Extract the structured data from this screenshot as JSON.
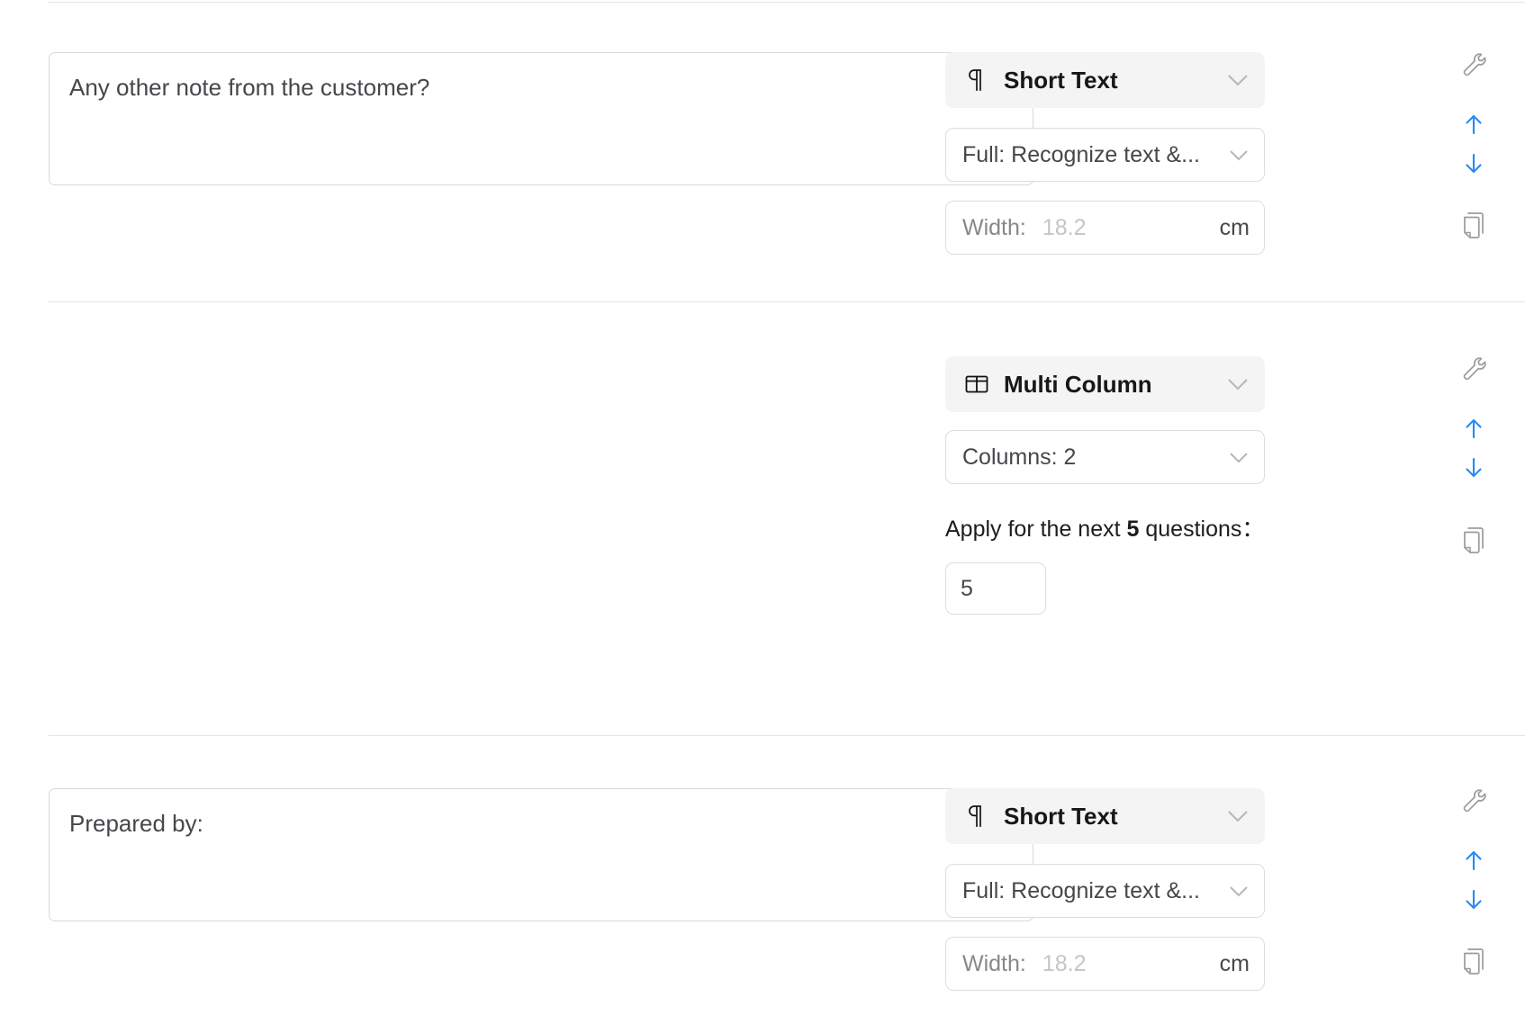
{
  "app": {
    "context": "form-question-editor",
    "accent_color": "#2689f5",
    "icon_grey": "#9a9c9f",
    "panel_bg": "#f4f4f5",
    "border_color": "#dcdddf"
  },
  "questions": [
    {
      "id": "q-any-other-note",
      "text": "Any other note from the customer?",
      "placeholder": "",
      "type": {
        "label": "Short Text",
        "icon": "pilcrow-icon"
      },
      "recognition": {
        "label": "Full: Recognize text &...",
        "icon": "chevron-down-icon"
      },
      "width": {
        "label": "Width:",
        "value": "18.2",
        "unit": "cm"
      },
      "tools": [
        {
          "name": "wrench-icon",
          "color": "#9a9c9f"
        },
        {
          "name": "arrow-up-icon",
          "color": "#2689f5"
        },
        {
          "name": "arrow-down-icon",
          "color": "#2689f5"
        },
        {
          "name": "duplicate-icon",
          "color": "#9a9c9f"
        }
      ]
    },
    {
      "id": "q-multi-column",
      "text": "",
      "placeholder": "",
      "type": {
        "label": "Multi Column",
        "icon": "multi-column-icon"
      },
      "columns": {
        "label": "Columns: 2",
        "icon": "chevron-down-icon"
      },
      "apply": {
        "prefix": "Apply for the next ",
        "count": "5",
        "suffix": " questions：",
        "input_value": "5"
      },
      "tools": [
        {
          "name": "wrench-icon",
          "color": "#9a9c9f"
        },
        {
          "name": "arrow-up-icon",
          "color": "#2689f5"
        },
        {
          "name": "arrow-down-icon",
          "color": "#2689f5"
        },
        {
          "name": "duplicate-icon",
          "color": "#9a9c9f"
        }
      ]
    },
    {
      "id": "q-prepared-by",
      "text": "Prepared by:",
      "placeholder": "",
      "type": {
        "label": "Short Text",
        "icon": "pilcrow-icon"
      },
      "recognition": {
        "label": "Full: Recognize text &...",
        "icon": "chevron-down-icon"
      },
      "width": {
        "label": "Width:",
        "value": "18.2",
        "unit": "cm"
      },
      "tools": [
        {
          "name": "wrench-icon",
          "color": "#9a9c9f"
        },
        {
          "name": "arrow-up-icon",
          "color": "#2689f5"
        },
        {
          "name": "arrow-down-icon",
          "color": "#2689f5"
        },
        {
          "name": "duplicate-icon",
          "color": "#9a9c9f"
        }
      ]
    }
  ]
}
